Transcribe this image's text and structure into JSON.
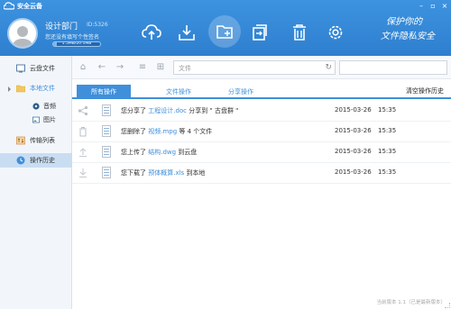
{
  "app": {
    "title": "安全云备"
  },
  "user": {
    "name": "设计部门",
    "id_label": "ID:5326",
    "signature": "您还没有填写个性签名",
    "quota_text": "1.5MB/20.1MB",
    "quota_fraction": 0.075
  },
  "header": {
    "slogan_line1": "保护你的",
    "slogan_line2": "文件隐私安全"
  },
  "toolbar": {
    "icons": [
      "upload-cloud-icon",
      "download-icon",
      "new-folder-icon",
      "share-icon",
      "delete-icon",
      "settings-icon"
    ],
    "active_index": 3
  },
  "sidebar": {
    "items": [
      {
        "label": "云盘文件",
        "icon": "cloud-icon"
      },
      {
        "label": "本地文件",
        "icon": "folder-icon"
      },
      {
        "label": "音频",
        "icon": "audio-icon"
      },
      {
        "label": "图片",
        "icon": "image-icon"
      },
      {
        "label": "传输列表",
        "icon": "transfer-icon"
      },
      {
        "label": "操作历史",
        "icon": "history-icon"
      }
    ]
  },
  "nav": {
    "path_placeholder": "文件"
  },
  "tabs": {
    "items": [
      "所有操作",
      "文件操作",
      "分享操作"
    ],
    "clear_history": "清空操作历史"
  },
  "history": [
    {
      "action_icon": "share-icon",
      "pre": "您分享了",
      "file": "工程设计.doc",
      "post": "分享到 \" 古盘群 \"",
      "date": "2015-03-26",
      "time": "15:35"
    },
    {
      "action_icon": "delete-icon",
      "pre": "您删除了",
      "file": "视频.mpg",
      "post": "等 4 个文件",
      "date": "2015-03-26",
      "time": "15:35"
    },
    {
      "action_icon": "upload-icon",
      "pre": "您上传了",
      "file": "结构.dwg",
      "post": "到云盘",
      "date": "2015-03-26",
      "time": "15:35"
    },
    {
      "action_icon": "download-icon",
      "pre": "您下载了",
      "file": "预体概算.xls",
      "post": "到本地",
      "date": "2015-03-26",
      "time": "15:35"
    }
  ],
  "footer": {
    "version": "当前版本 1.1（已是最新版本）"
  },
  "colors": {
    "header_top": "#3d93e0",
    "accent": "#3f8fdb",
    "sidebar_bg": "#f2f6fb",
    "selected_bg": "#c9ddf2"
  }
}
